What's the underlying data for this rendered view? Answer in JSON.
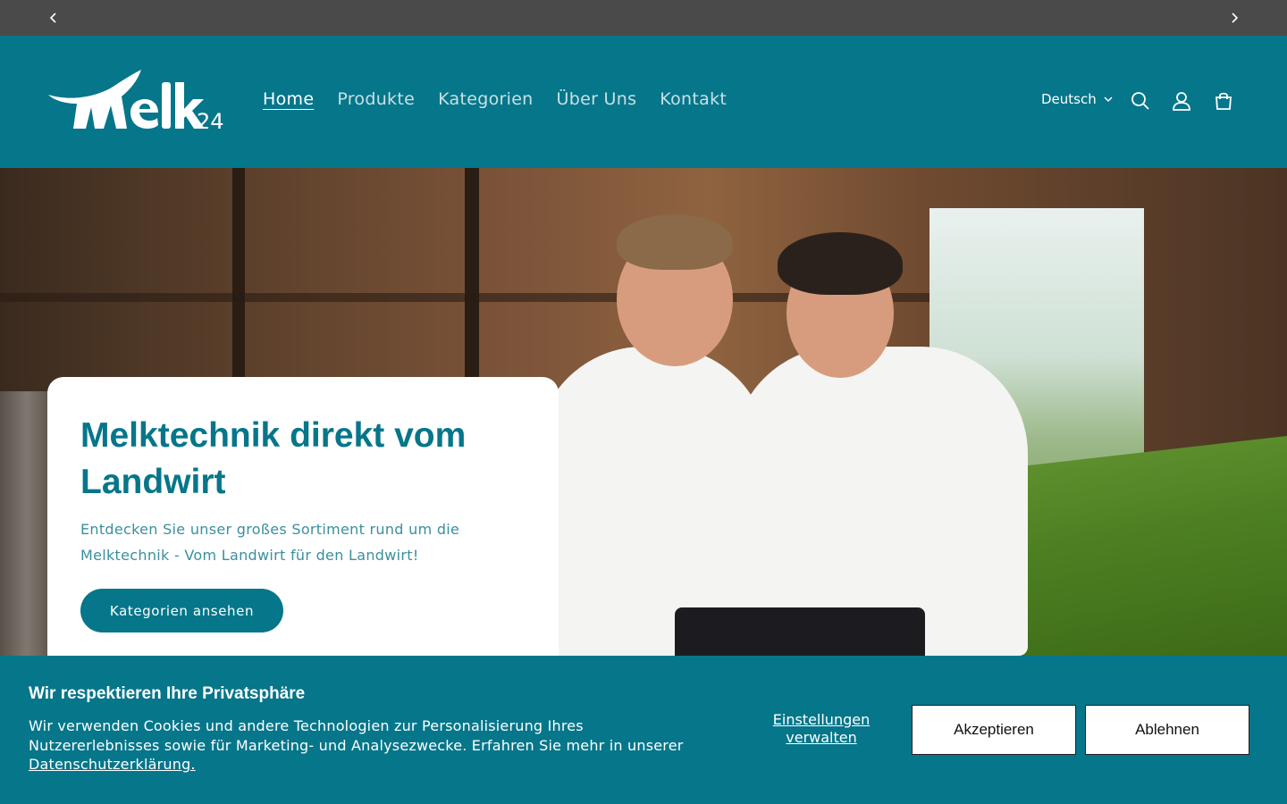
{
  "announcement": {
    "prev_icon": "chevron-left-icon",
    "next_icon": "chevron-right-icon"
  },
  "header": {
    "logo_text": "Melk24",
    "nav": [
      {
        "label": "Home",
        "active": true
      },
      {
        "label": "Produkte",
        "active": false
      },
      {
        "label": "Kategorien",
        "active": false
      },
      {
        "label": "Über Uns",
        "active": false
      },
      {
        "label": "Kontakt",
        "active": false
      }
    ],
    "language": "Deutsch",
    "icons": [
      "search-icon",
      "account-icon",
      "cart-icon"
    ]
  },
  "hero": {
    "title": "Melktechnik direkt vom Landwirt",
    "text": "Entdecken Sie unser großes Sortiment rund um die Melktechnik - Vom Landwirt für den Landwirt!",
    "button": "Kategorien ansehen"
  },
  "cookie": {
    "title": "Wir respektieren Ihre Privatsphäre",
    "text": "Wir verwenden Cookies und andere Technologien zur Personalisierung Ihres Nutzererlebnisses sowie für Marketing- und Analysezwecke. Erfahren Sie mehr in unserer",
    "link": "Datenschutzerklärung.",
    "manage": "Einstellungen verwalten",
    "accept": "Akzeptieren",
    "decline": "Ablehnen"
  },
  "colors": {
    "brand": "#06768a",
    "announcement_bg": "#4a4a4a",
    "white": "#ffffff"
  }
}
